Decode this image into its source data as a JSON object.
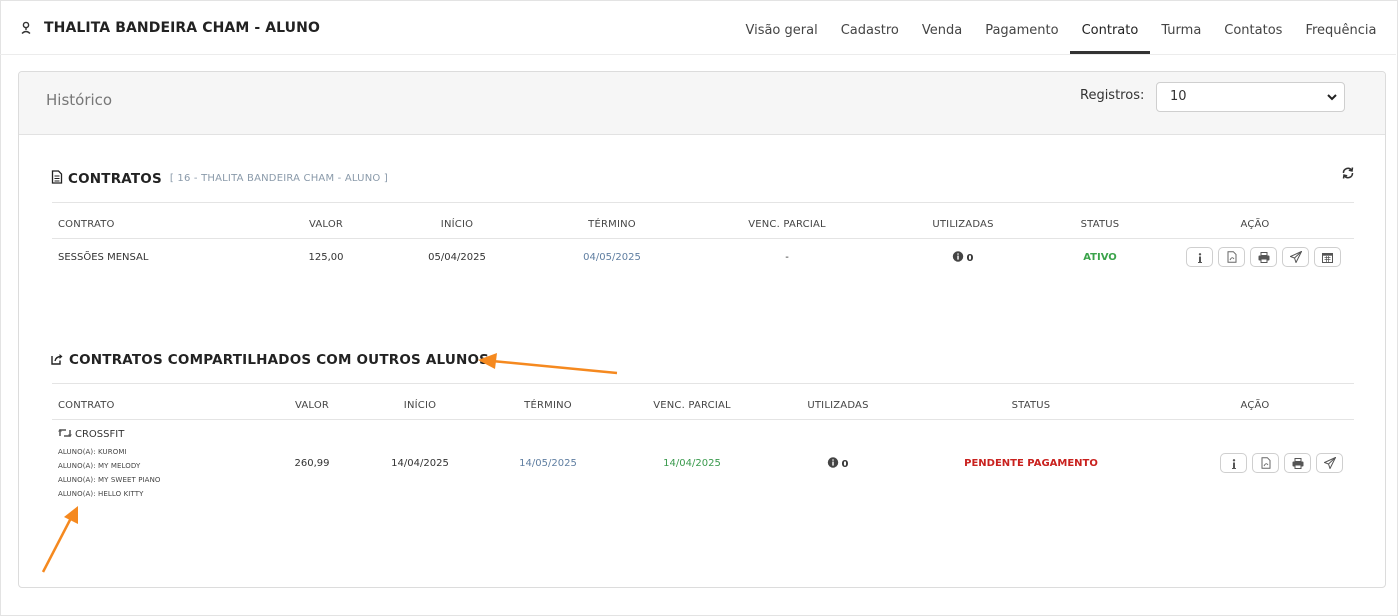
{
  "header": {
    "student_name": "THALITA BANDEIRA CHAM - ALUNO",
    "tabs": [
      {
        "label": "Visão geral",
        "active": false
      },
      {
        "label": "Cadastro",
        "active": false
      },
      {
        "label": "Venda",
        "active": false
      },
      {
        "label": "Pagamento",
        "active": false
      },
      {
        "label": "Contrato",
        "active": true
      },
      {
        "label": "Turma",
        "active": false
      },
      {
        "label": "Contatos",
        "active": false
      },
      {
        "label": "Frequência",
        "active": false
      }
    ]
  },
  "panel": {
    "title": "Histórico",
    "registros_label": "Registros:",
    "registros_value": "10"
  },
  "contratos": {
    "title": "CONTRATOS",
    "subtitle": "[ 16 - THALITA BANDEIRA CHAM - ALUNO ]",
    "columns": {
      "contrato": "CONTRATO",
      "valor": "VALOR",
      "inicio": "INÍCIO",
      "termino": "TÉRMINO",
      "venc_parcial": "VENC. PARCIAL",
      "utilizadas": "UTILIZADAS",
      "status": "STATUS",
      "acao": "AÇÃO"
    },
    "row": {
      "contrato": "SESSÕES MENSAL",
      "valor": "125,00",
      "inicio": "05/04/2025",
      "termino": "04/05/2025",
      "venc_parcial": "-",
      "utilizadas": "0",
      "status": "ATIVO",
      "status_color": "#3aa34a"
    }
  },
  "compartilhados": {
    "title": "CONTRATOS COMPARTILHADOS COM OUTROS ALUNOS",
    "columns": {
      "contrato": "CONTRATO",
      "valor": "VALOR",
      "inicio": "INÍCIO",
      "termino": "TÉRMINO",
      "venc_parcial": "VENC. PARCIAL",
      "utilizadas": "UTILIZADAS",
      "status": "STATUS",
      "acao": "AÇÃO"
    },
    "row": {
      "contrato": "CROSSFIT",
      "alunos": [
        "ALUNO(A): KUROMI",
        "ALUNO(A): MY MELODY",
        "ALUNO(A): MY SWEET PIANO",
        "ALUNO(A): HELLO KITTY"
      ],
      "valor": "260,99",
      "inicio": "14/04/2025",
      "termino": "14/05/2025",
      "venc_parcial": "14/04/2025",
      "utilizadas": "0",
      "status": "PENDENTE PAGAMENTO",
      "status_color": "#c9211e"
    }
  },
  "colors": {
    "annotation_arrow": "#f5891f",
    "link_blue": "#5f7ea1",
    "green": "#3a9a4d"
  },
  "icons": [
    "person-icon",
    "file-text-icon",
    "share-icon",
    "refresh-icon",
    "info-icon",
    "pdf-icon",
    "print-icon",
    "send-icon",
    "calendar-icon",
    "retweet-icon",
    "chevron-down-icon"
  ]
}
